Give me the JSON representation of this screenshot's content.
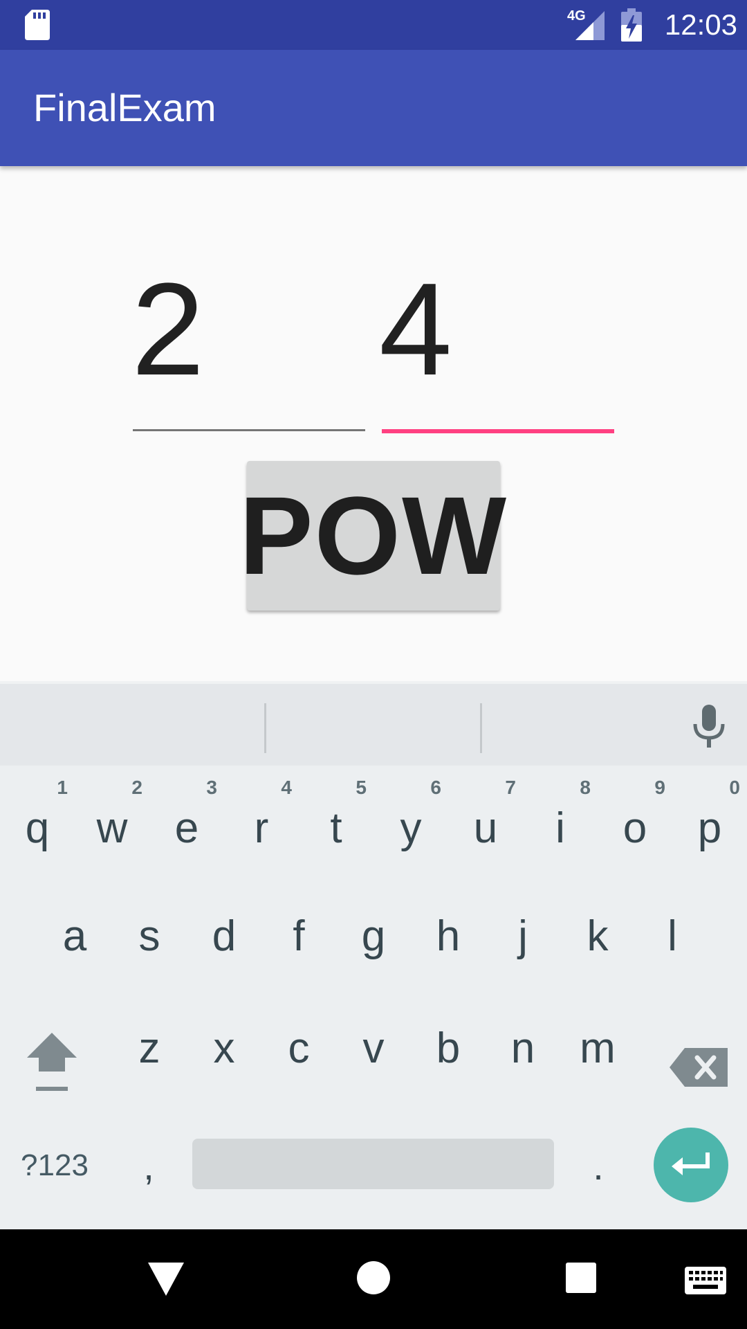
{
  "status_bar": {
    "time": "12:03",
    "network": "4G",
    "icons": [
      "sd-card-icon",
      "signal-icon",
      "battery-charging-icon"
    ]
  },
  "app": {
    "title": "FinalExam"
  },
  "inputs": {
    "base_value": "2",
    "exponent_value": "4",
    "active_field": "exponent"
  },
  "pow_button": {
    "label": "POW"
  },
  "keyboard": {
    "row1": [
      {
        "ch": "q",
        "hint": "1"
      },
      {
        "ch": "w",
        "hint": "2"
      },
      {
        "ch": "e",
        "hint": "3"
      },
      {
        "ch": "r",
        "hint": "4"
      },
      {
        "ch": "t",
        "hint": "5"
      },
      {
        "ch": "y",
        "hint": "6"
      },
      {
        "ch": "u",
        "hint": "7"
      },
      {
        "ch": "i",
        "hint": "8"
      },
      {
        "ch": "o",
        "hint": "9"
      },
      {
        "ch": "p",
        "hint": "0"
      }
    ],
    "row2": [
      "a",
      "s",
      "d",
      "f",
      "g",
      "h",
      "j",
      "k",
      "l"
    ],
    "row3": [
      "z",
      "x",
      "c",
      "v",
      "b",
      "n",
      "m"
    ],
    "symbols_label": "?123",
    "comma_label": ",",
    "period_label": ".",
    "icons": [
      "shift-icon",
      "backspace-icon",
      "mic-icon",
      "enter-icon"
    ]
  },
  "nav_bar": {
    "icons": [
      "back-icon",
      "home-icon",
      "recents-icon",
      "keyboard-icon"
    ]
  },
  "colors": {
    "status_bar": "#303f9f",
    "app_bar": "#3f51b5",
    "accent": "#ff4081",
    "enter_key": "#4db6ac",
    "keyboard_bg": "#eceff1"
  }
}
